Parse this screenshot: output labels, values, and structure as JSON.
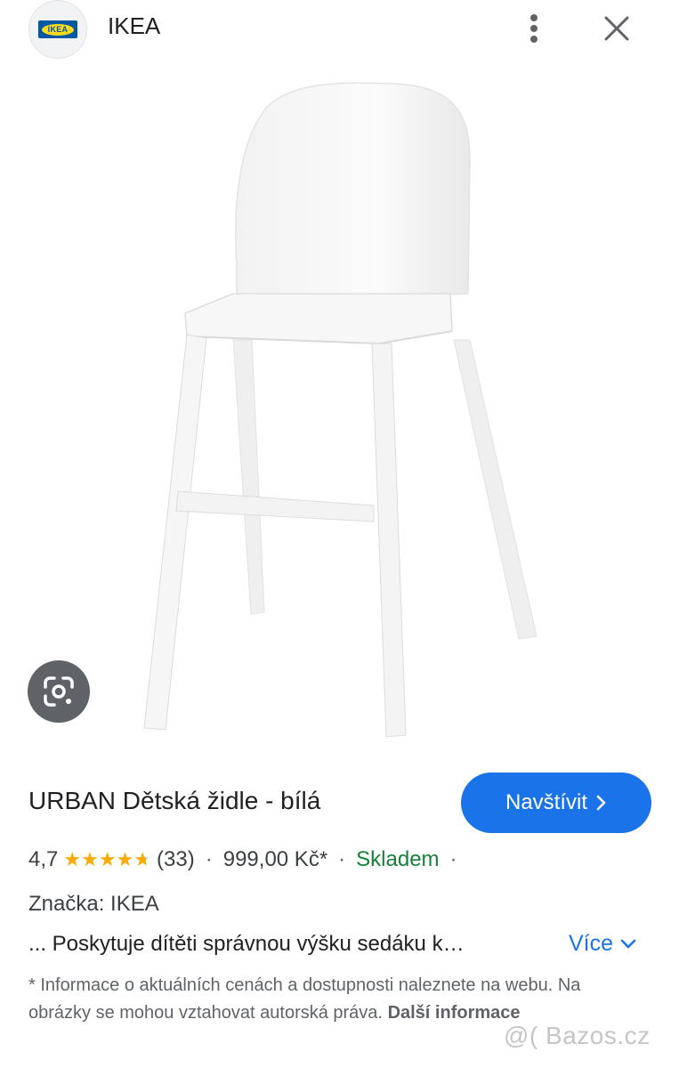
{
  "header": {
    "logo_text": "IKEA",
    "site_name": "IKEA",
    "menu_icon": "more-vert-icon",
    "close_icon": "close-icon"
  },
  "image": {
    "lens_icon": "google-lens-icon"
  },
  "product": {
    "title": "URBAN Dětská židle - bílá",
    "visit_label": "Navštívit",
    "rating": "4,7",
    "rating_value": 4.7,
    "review_count": "(33)",
    "price": "999,00 Kč*",
    "availability": "Skladem",
    "brand": "Značka: IKEA",
    "description": "... Poskytuje dítěti správnou výšku sedáku k…",
    "more_label": "Více"
  },
  "disclaimer": {
    "text": "* Informace o aktuálních cenách a dostupnosti naleznete na webu. Na obrázky se mohou vztahovat autorská práva.",
    "link": "Další informace"
  },
  "watermark": "@( Bazos.cz",
  "colors": {
    "accent": "#1a73e8",
    "star": "#f9ab00",
    "stock": "#188038",
    "ikea_blue": "#0058a3",
    "ikea_yellow": "#ffda1a"
  }
}
